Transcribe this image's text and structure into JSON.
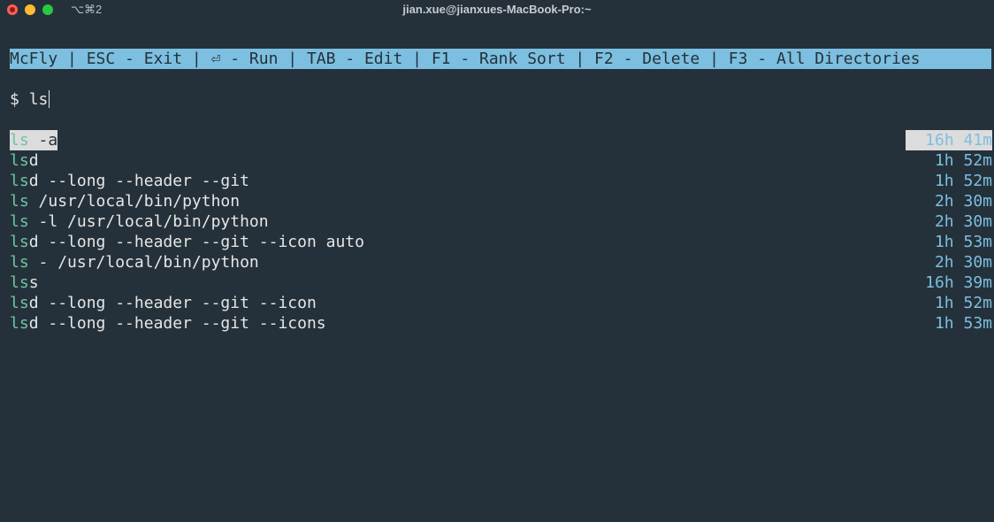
{
  "titlebar": {
    "tab_shortcut": "⌥⌘2",
    "title": "jian.xue@jianxues-MacBook-Pro:~"
  },
  "help_bar": "McFly | ESC - Exit | ⏎ - Run | TAB - Edit | F1 - Rank Sort | F2 - Delete | F3 - All Directories",
  "prompt": {
    "symbol": "$",
    "query": "ls"
  },
  "results": [
    {
      "match": "ls",
      "rest": " -a",
      "time": "16h 41m",
      "selected": true
    },
    {
      "match": "ls",
      "rest": "d",
      "time": "1h 52m"
    },
    {
      "match": "ls",
      "rest": "d --long --header --git",
      "time": "1h 52m"
    },
    {
      "match": "ls",
      "rest": " /usr/local/bin/python",
      "time": "2h 30m"
    },
    {
      "match": "ls",
      "rest": " -l /usr/local/bin/python",
      "time": "2h 30m"
    },
    {
      "match": "ls",
      "rest": "d --long --header --git --icon auto",
      "time": "1h 53m"
    },
    {
      "match": "ls",
      "rest": " - /usr/local/bin/python",
      "time": "2h 30m"
    },
    {
      "match": "ls",
      "rest": "s",
      "time": "16h 39m"
    },
    {
      "match": "ls",
      "rest": "d --long --header --git --icon",
      "time": "1h 52m"
    },
    {
      "match": "ls",
      "rest": "d --long --header --git --icons",
      "time": "1h 53m"
    }
  ]
}
